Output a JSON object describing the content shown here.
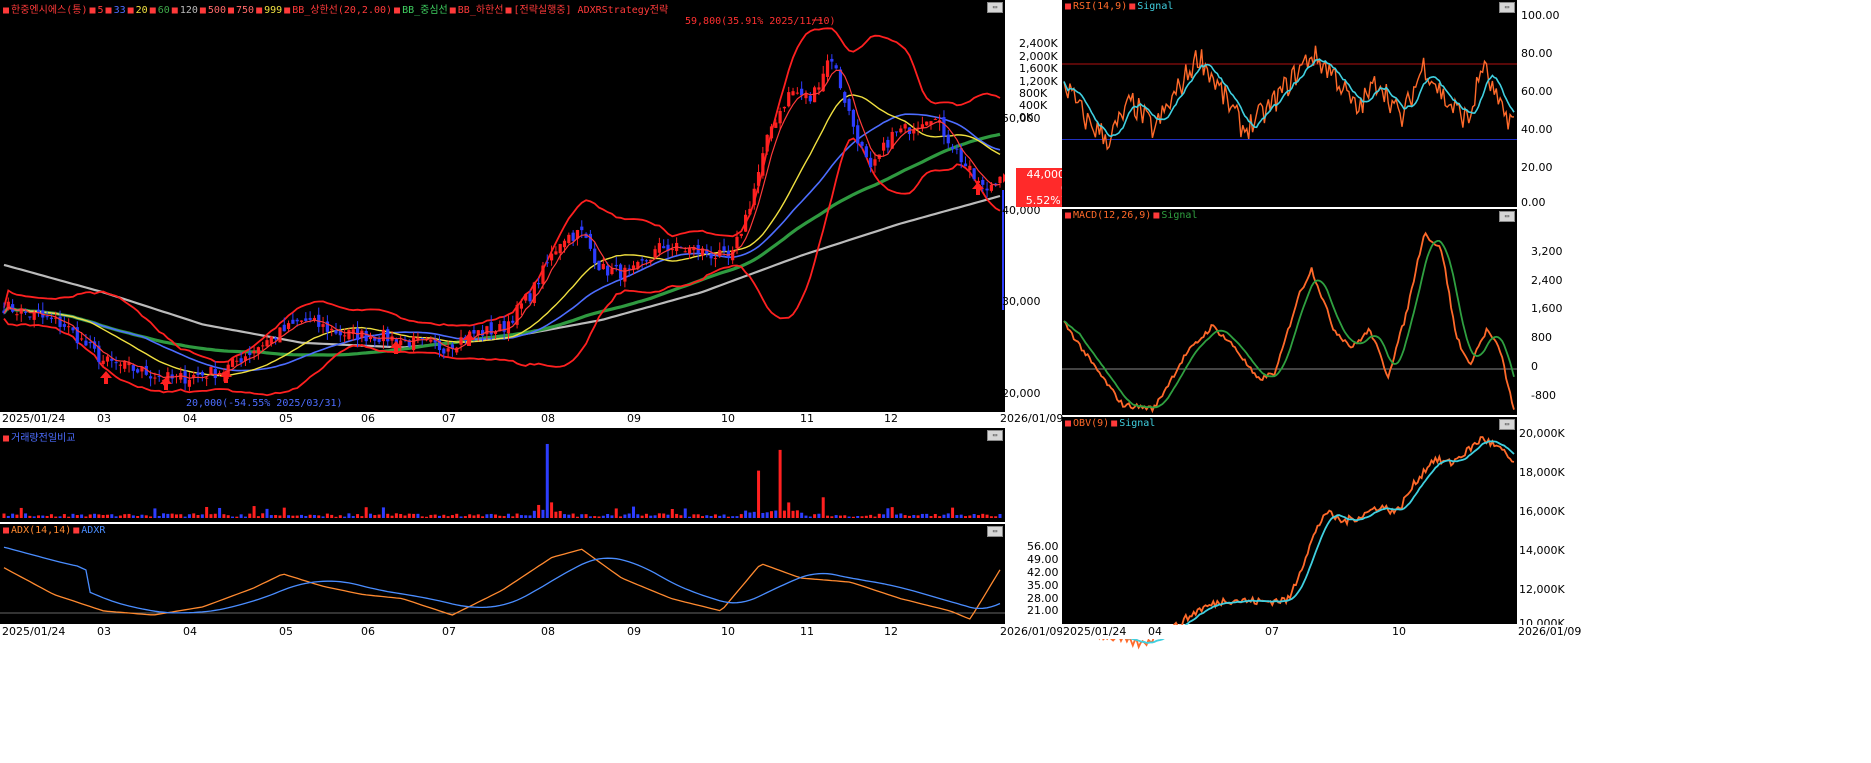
{
  "main_panel": {
    "legend": [
      {
        "text": "한중엔시에스(통)",
        "color": "#ff3a3a"
      },
      {
        "text": "5",
        "color": "#ff3a3a"
      },
      {
        "text": "33",
        "color": "#4d6dff"
      },
      {
        "text": "20",
        "color": "#f0e040"
      },
      {
        "text": "60",
        "color": "#3fa84a"
      },
      {
        "text": "120",
        "color": "#bbbbbb"
      },
      {
        "text": "500",
        "color": "#ff6a6a"
      },
      {
        "text": "750",
        "color": "#ff6a6a"
      },
      {
        "text": "999",
        "color": "#f0e040"
      },
      {
        "text": "BB_상한선(20,2.00)",
        "color": "#ff3a3a"
      },
      {
        "text": "BB_중심선",
        "color": "#3fd060"
      },
      {
        "text": "BB_하한선",
        "color": "#ff3a3a"
      },
      {
        "text": "[전략실행중] ADXRStrategy전략",
        "color": "#ff3a3a"
      }
    ],
    "high_annotation": "59,800(35.91% 2025/11/10)",
    "low_annotation": "20,000(-54.55% 2025/03/31)",
    "price_axis": [
      "50,000",
      "40,000",
      "30,000",
      "20,000"
    ],
    "current_price": "44,000",
    "current_change": "( 5.52%)",
    "x_axis": [
      "2025/01/24",
      "03",
      "04",
      "05",
      "06",
      "07",
      "08",
      "09",
      "10",
      "11",
      "12",
      "2026/01/09"
    ],
    "colors": {
      "up": "#ff2020",
      "down": "#2d3dff",
      "ma5": "#ff3a3a",
      "ma20": "#f0e040",
      "ma60": "#2f9a40",
      "ma120": "#bbbbbb",
      "ma33": "#4d6dff",
      "bb": "#ff2020"
    }
  },
  "volume_panel": {
    "legend": "거래량전일비교",
    "axis": [
      "2,400K",
      "2,000K",
      "1,600K",
      "1,200K",
      "800K",
      "400K",
      "0K"
    ]
  },
  "adx_panel": {
    "legend": [
      {
        "text": "ADX(14,14)",
        "color": "#ff8a30"
      },
      {
        "text": "ADXR",
        "color": "#4a8dff"
      }
    ],
    "axis": [
      "56.00",
      "49.00",
      "42.00",
      "35.00",
      "28.00",
      "21.00"
    ],
    "x_axis": [
      "2025/01/24",
      "03",
      "04",
      "05",
      "06",
      "07",
      "08",
      "09",
      "10",
      "11",
      "12",
      "2026/01/09"
    ]
  },
  "rsi_panel": {
    "legend": [
      {
        "text": "RSI(14,9)",
        "color": "#ff6a2a"
      },
      {
        "text": "Signal",
        "color": "#40d0e0"
      }
    ],
    "axis": [
      "100.00",
      "80.00",
      "60.00",
      "40.00",
      "20.00",
      "0.00"
    ]
  },
  "macd_panel": {
    "legend": [
      {
        "text": "MACD(12,26,9)",
        "color": "#ff6a2a"
      },
      {
        "text": "Signal",
        "color": "#2fa040"
      }
    ],
    "axis": [
      "3,200",
      "2,400",
      "1,600",
      "800",
      "0",
      "-800"
    ]
  },
  "obv_panel": {
    "legend": [
      {
        "text": "OBV(9)",
        "color": "#ff6a2a"
      },
      {
        "text": "Signal",
        "color": "#40d0e0"
      }
    ],
    "axis": [
      "20,000K",
      "18,000K",
      "16,000K",
      "14,000K",
      "12,000K",
      "10,000K"
    ],
    "x_axis": [
      "2025/01/24",
      "04",
      "07",
      "10",
      "2026/01/09"
    ]
  }
}
